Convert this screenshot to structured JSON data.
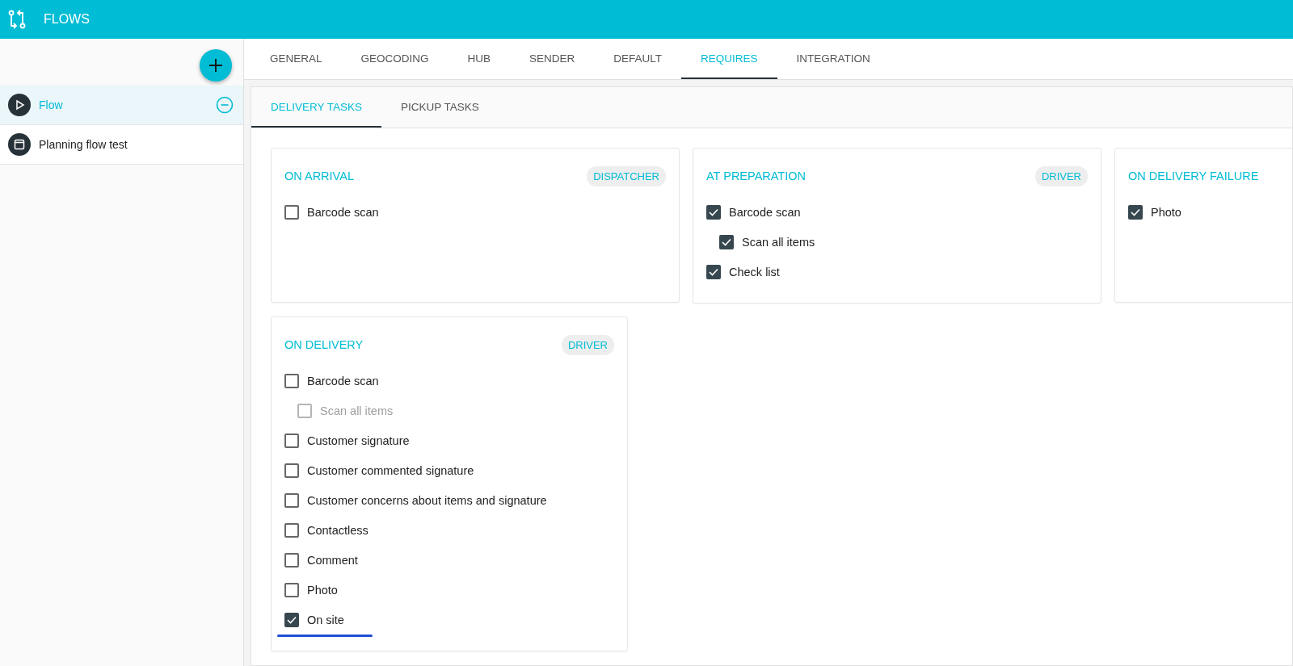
{
  "app_bar": {
    "title": "FLOWS"
  },
  "sidebar": {
    "items": [
      {
        "label": "Flow",
        "kind": "flow",
        "selected": true
      },
      {
        "label": "Planning flow test",
        "kind": "planning",
        "selected": false
      }
    ]
  },
  "tabs": [
    {
      "label": "GENERAL",
      "selected": false
    },
    {
      "label": "GEOCODING",
      "selected": false
    },
    {
      "label": "HUB",
      "selected": false
    },
    {
      "label": "SENDER",
      "selected": false
    },
    {
      "label": "DEFAULT",
      "selected": false
    },
    {
      "label": "REQUIRES",
      "selected": true
    },
    {
      "label": "INTEGRATION",
      "selected": false
    }
  ],
  "sub_tabs": [
    {
      "label": "DELIVERY TASKS",
      "selected": true
    },
    {
      "label": "PICKUP TASKS",
      "selected": false
    }
  ],
  "cards": [
    {
      "title": "ON ARRIVAL",
      "role": "DISPATCHER",
      "items": [
        {
          "label": "Barcode scan",
          "checked": false,
          "disabled": false,
          "highlighted": false
        }
      ]
    },
    {
      "title": "AT PREPARATION",
      "role": "DRIVER",
      "items": [
        {
          "label": "Barcode scan",
          "checked": true,
          "disabled": false,
          "highlighted": false,
          "children": [
            {
              "label": "Scan all items",
              "checked": true,
              "disabled": false,
              "highlighted": false
            }
          ]
        },
        {
          "label": "Check list",
          "checked": true,
          "disabled": false,
          "highlighted": false
        }
      ]
    },
    {
      "title": "ON DELIVERY FAILURE",
      "items": [
        {
          "label": "Photo",
          "checked": true,
          "disabled": false,
          "highlighted": false
        }
      ]
    },
    {
      "title": "ON DELIVERY",
      "role": "DRIVER",
      "items": [
        {
          "label": "Barcode scan",
          "checked": false,
          "disabled": false,
          "highlighted": false,
          "children": [
            {
              "label": "Scan all items",
              "checked": false,
              "disabled": true,
              "highlighted": false
            }
          ]
        },
        {
          "label": "Customer signature",
          "checked": false,
          "disabled": false,
          "highlighted": false
        },
        {
          "label": "Customer commented signature",
          "checked": false,
          "disabled": false,
          "highlighted": false
        },
        {
          "label": "Customer concerns about items and signature",
          "checked": false,
          "disabled": false,
          "highlighted": false
        },
        {
          "label": "Contactless",
          "checked": false,
          "disabled": false,
          "highlighted": false
        },
        {
          "label": "Comment",
          "checked": false,
          "disabled": false,
          "highlighted": false
        },
        {
          "label": "Photo",
          "checked": false,
          "disabled": false,
          "highlighted": false
        },
        {
          "label": "On site",
          "checked": true,
          "disabled": false,
          "highlighted": true
        }
      ]
    }
  ]
}
